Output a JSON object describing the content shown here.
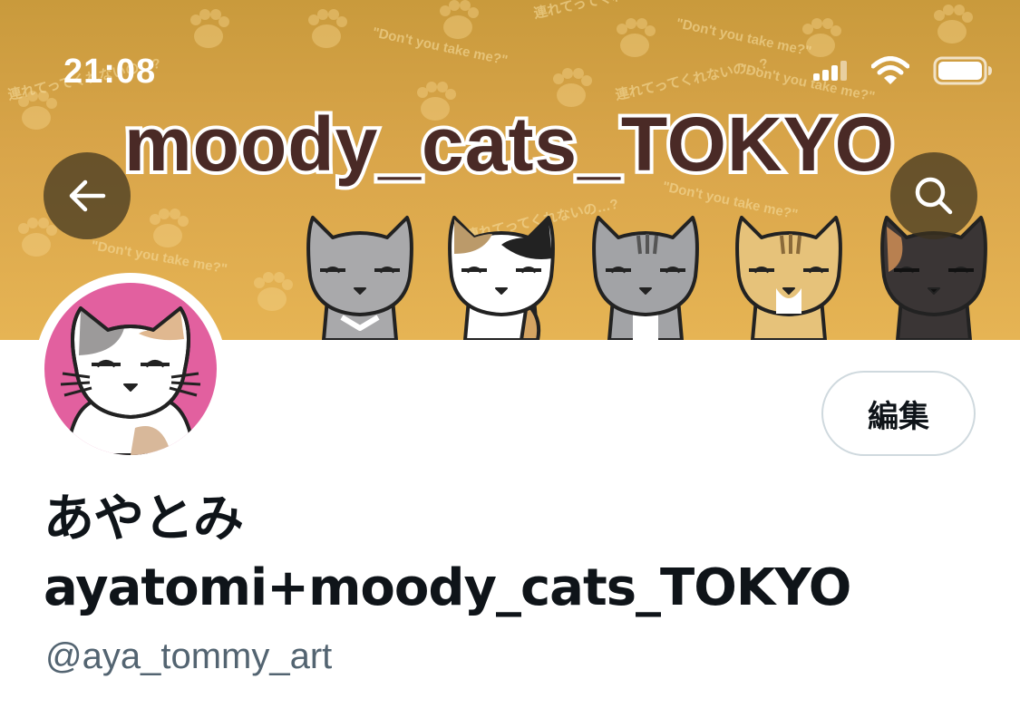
{
  "status_bar": {
    "time": "21:08",
    "icons": [
      "signal-icon",
      "wifi-icon",
      "battery-icon"
    ]
  },
  "header": {
    "banner": {
      "title": "moody_cats_TOKYO",
      "background_text_en": "\"Don't you take me?\"",
      "background_text_ja": "連れてってくれないの…?",
      "colors": {
        "background": "#d9a54a",
        "title_fill": "#4a2a26",
        "title_outline": "#ffffff"
      }
    },
    "back_button_icon": "arrow-left-icon",
    "search_button_icon": "search-icon"
  },
  "profile": {
    "avatar": {
      "background": "#e2609f",
      "icon": "calico-cat-avatar"
    },
    "edit_label": "編集",
    "display_name_line1": "あやとみ",
    "display_name_line2": "ayatomi+moody_cats_TOKYO",
    "handle": "@aya_tommy_art"
  },
  "colors": {
    "text_primary": "#0f1419",
    "text_secondary": "#536471",
    "button_border": "#cfd9de"
  }
}
